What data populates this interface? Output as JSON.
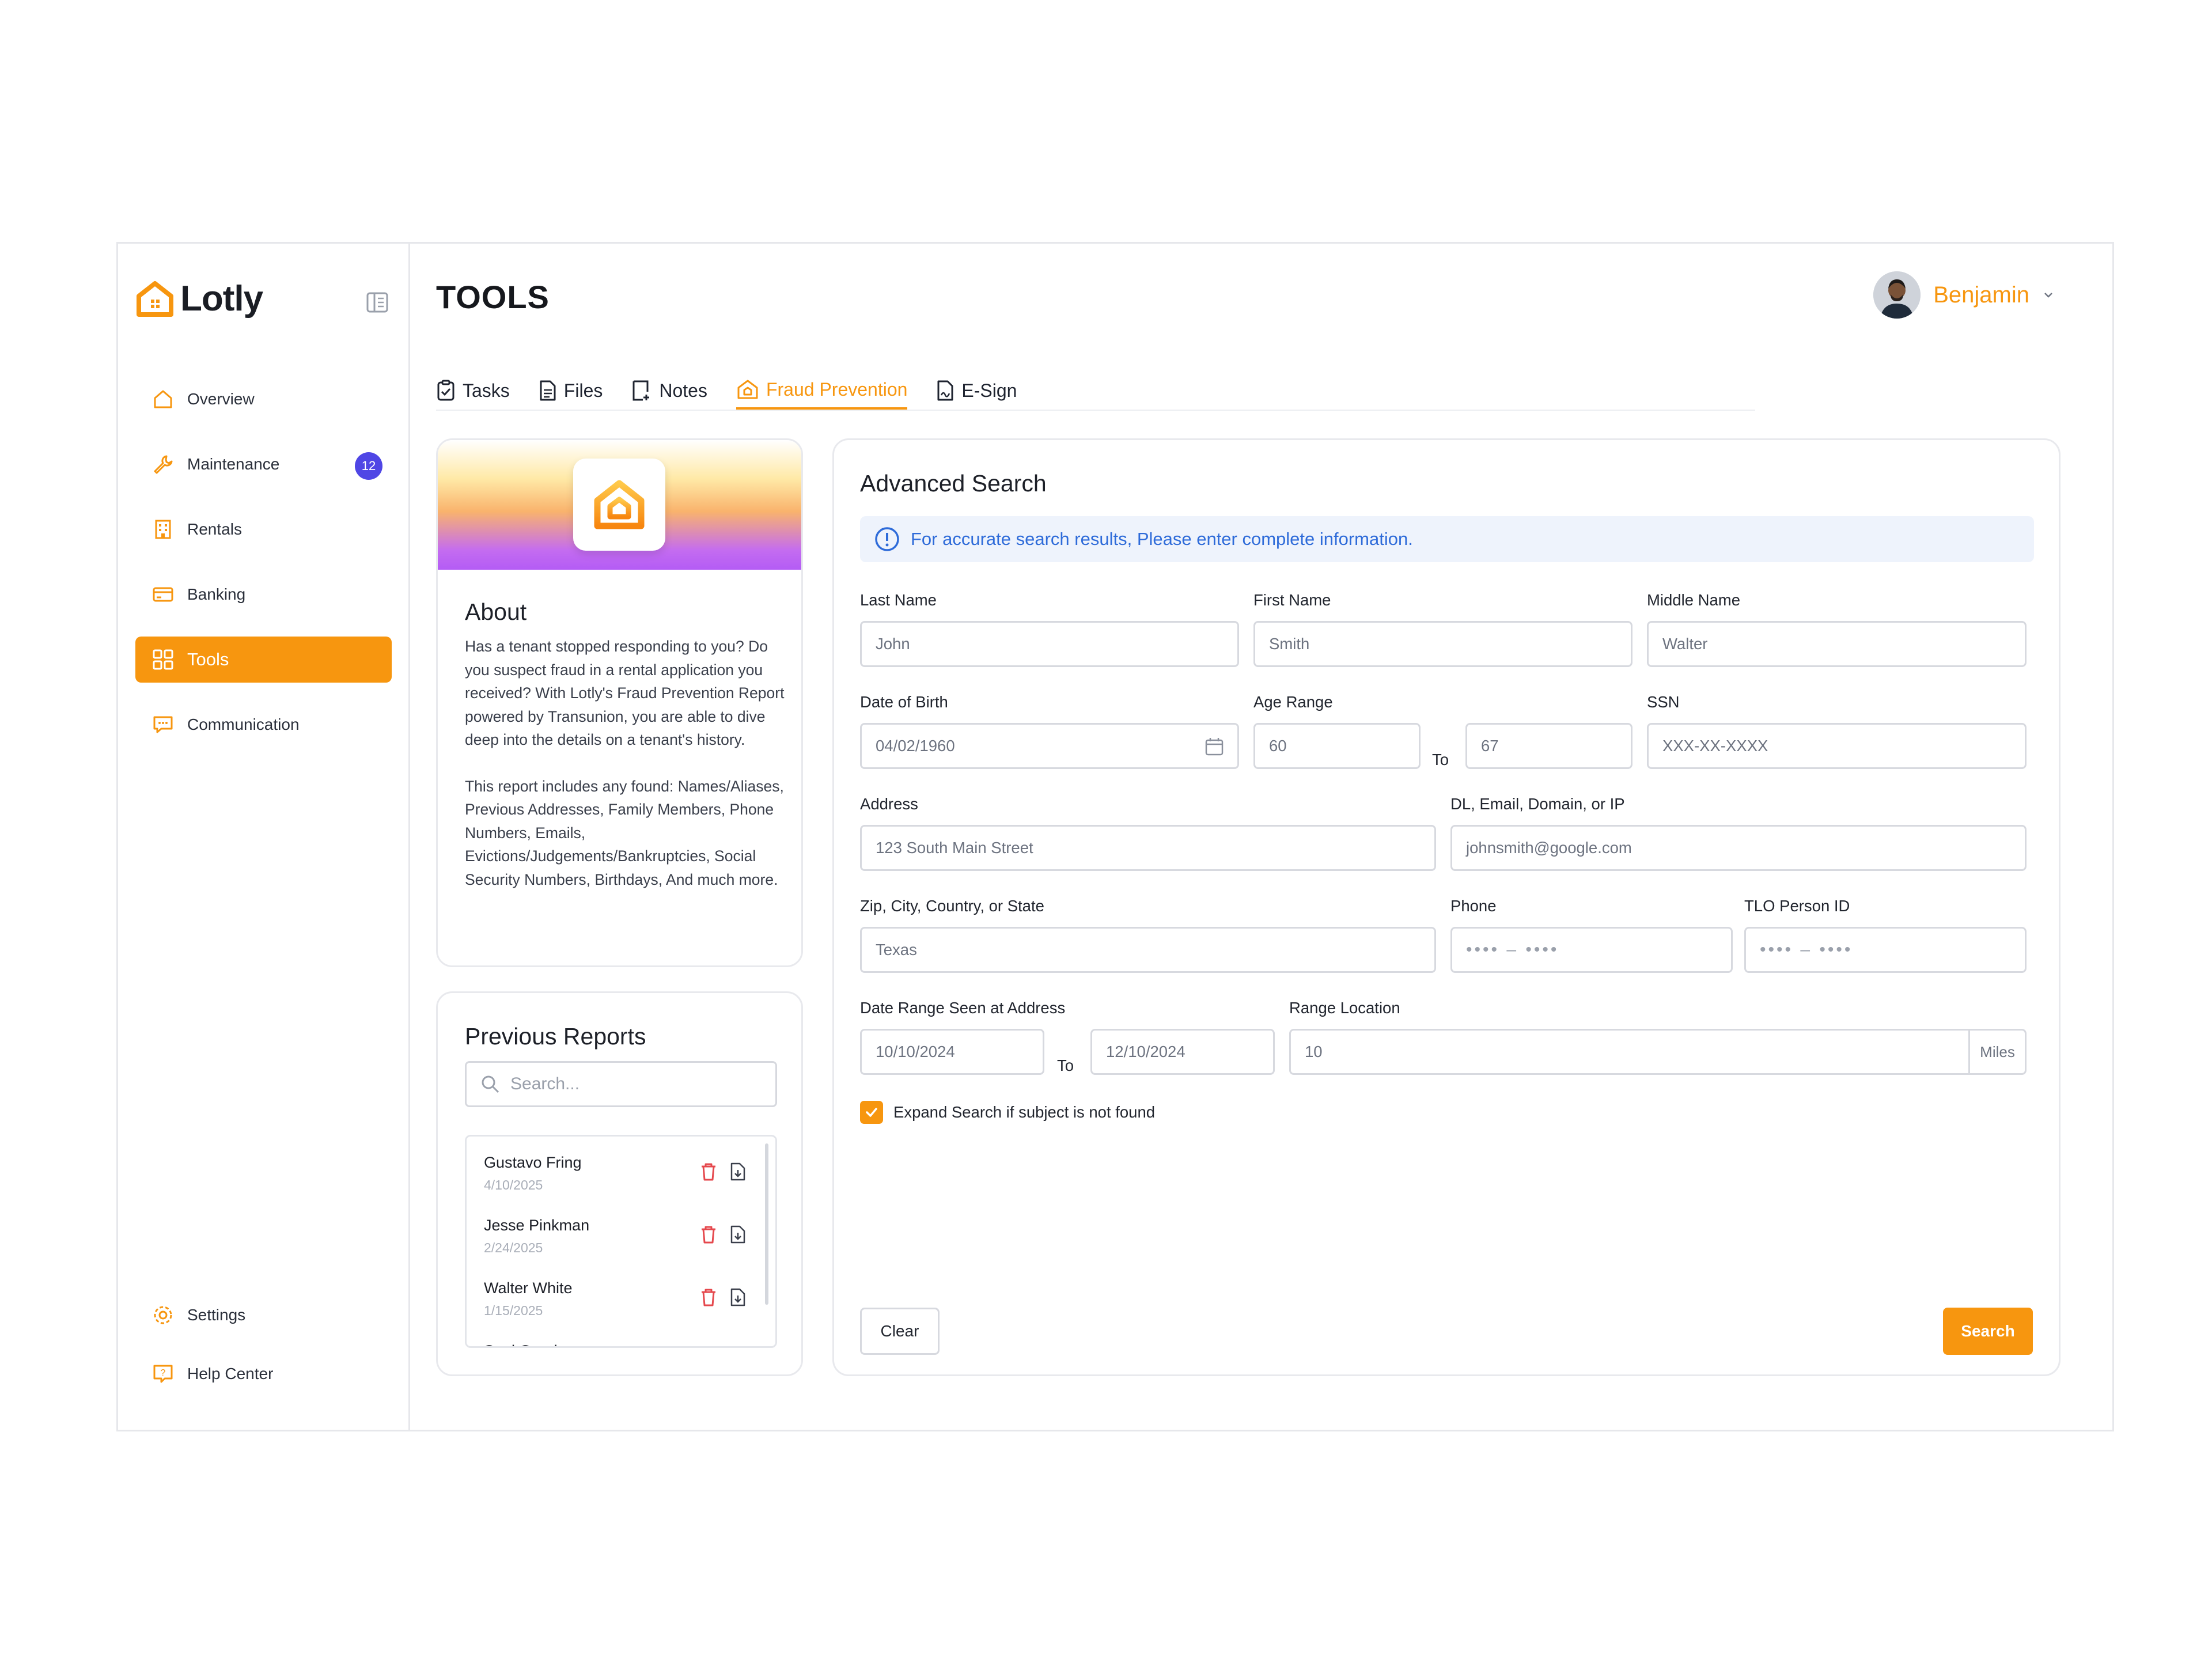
{
  "app": {
    "name": "Lotly",
    "accent": "#f7960f"
  },
  "sidebar": {
    "items": [
      {
        "label": "Overview",
        "icon": "house-icon"
      },
      {
        "label": "Maintenance",
        "icon": "wrench-icon",
        "badge": "12"
      },
      {
        "label": "Rentals",
        "icon": "building-icon"
      },
      {
        "label": "Banking",
        "icon": "card-icon"
      },
      {
        "label": "Tools",
        "icon": "grid-icon",
        "active": true
      },
      {
        "label": "Communication",
        "icon": "chat-icon"
      }
    ],
    "bottom": [
      {
        "label": "Settings",
        "icon": "gear-icon"
      },
      {
        "label": "Help Center",
        "icon": "help-icon"
      }
    ]
  },
  "header": {
    "title": "TOOLS",
    "user_name": "Benjamin"
  },
  "tabs": [
    {
      "label": "Tasks",
      "icon": "clipboard-icon"
    },
    {
      "label": "Files",
      "icon": "file-icon"
    },
    {
      "label": "Notes",
      "icon": "note-icon"
    },
    {
      "label": "Fraud Prevention",
      "icon": "shield-house-icon",
      "active": true
    },
    {
      "label": "E-Sign",
      "icon": "esign-icon"
    }
  ],
  "about": {
    "title": "About",
    "paragraph1": "Has a tenant stopped responding to you? Do you suspect fraud in a rental application you received? With Lotly's Fraud Prevention Report powered by Transunion, you are able to dive deep into the details on a tenant's history.",
    "paragraph2": "This report includes any found: Names/Aliases, Previous Addresses, Family Members, Phone Numbers, Emails, Evictions/Judgements/Bankruptcies, Social Security Numbers, Birthdays, And much more."
  },
  "previous_reports": {
    "title": "Previous Reports",
    "search_placeholder": "Search...",
    "items": [
      {
        "name": "Gustavo Fring",
        "date": "4/10/2025"
      },
      {
        "name": "Jesse Pinkman",
        "date": "2/24/2025"
      },
      {
        "name": "Walter White",
        "date": "1/15/2025"
      },
      {
        "name": "Saul Goodman",
        "date": ""
      }
    ]
  },
  "advanced_search": {
    "title": "Advanced Search",
    "info": "For accurate search results, Please enter complete information.",
    "last_name": {
      "label": "Last Name",
      "value": "John"
    },
    "first_name": {
      "label": "First Name",
      "value": "Smith"
    },
    "middle_name": {
      "label": "Middle Name",
      "value": "Walter"
    },
    "dob": {
      "label": "Date of Birth",
      "value": "04/02/1960"
    },
    "age_range": {
      "label": "Age Range",
      "from": "60",
      "to_label": "To",
      "to": "67"
    },
    "ssn": {
      "label": "SSN",
      "value": "XXX-XX-XXXX"
    },
    "address": {
      "label": "Address",
      "value": "123 South Main Street"
    },
    "dl": {
      "label": "DL, Email, Domain, or IP",
      "value": "johnsmith@google.com"
    },
    "zip": {
      "label": "Zip, City, Country, or State",
      "value": "Texas"
    },
    "phone": {
      "label": "Phone",
      "value": "•••• – ••••"
    },
    "tlo": {
      "label": "TLO Person ID",
      "value": "•••• – ••••"
    },
    "date_range": {
      "label": "Date Range Seen at Address",
      "from": "10/10/2024",
      "to_label": "To",
      "to": "12/10/2024"
    },
    "range_location": {
      "label": "Range Location",
      "value": "10",
      "unit": "Miles"
    },
    "expand": {
      "label": "Expand Search if subject is not found",
      "checked": true
    },
    "clear_label": "Clear",
    "search_label": "Search"
  }
}
